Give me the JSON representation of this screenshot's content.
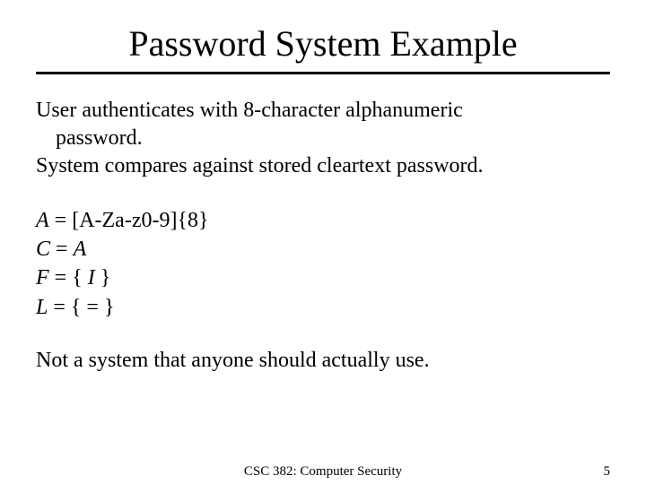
{
  "title": "Password System Example",
  "body": {
    "line1": "User authenticates with 8-character alphanumeric",
    "line2": "password.",
    "line3": "System compares against stored cleartext password."
  },
  "formulas": {
    "f1_var": "A",
    "f1_rest": " = [A-Za-z0-9]{8}",
    "f2_var": "C",
    "f2_rest": " = ",
    "f2_var2": "A",
    "f3_var": "F",
    "f3_rest": " = { ",
    "f3_var2": "I",
    "f3_rest2": " }",
    "f4_var": "L",
    "f4_rest": " = { = }"
  },
  "closing": "Not a system that anyone should actually use.",
  "footer": {
    "center": "CSC 382: Computer Security",
    "page": "5"
  }
}
